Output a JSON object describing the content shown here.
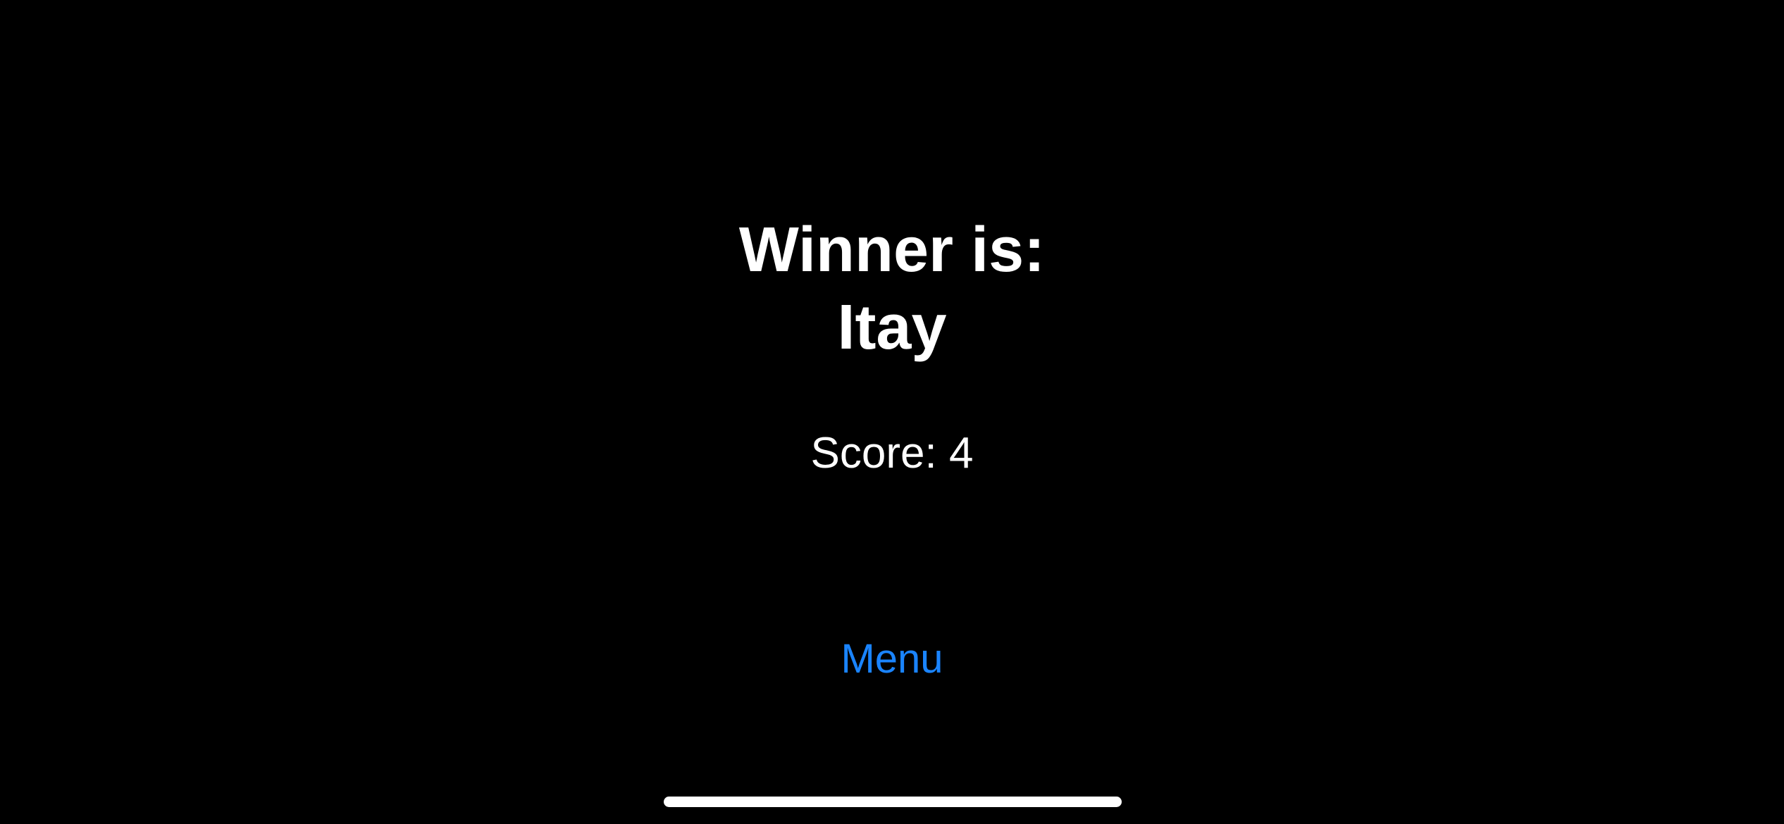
{
  "result": {
    "title": "Winner is:",
    "winner_name": "Itay",
    "score_text": "Score: 4"
  },
  "actions": {
    "menu_label": "Menu"
  },
  "colors": {
    "background": "#000000",
    "text": "#ffffff",
    "accent": "#1a84ff",
    "home_indicator": "#ffffff"
  }
}
